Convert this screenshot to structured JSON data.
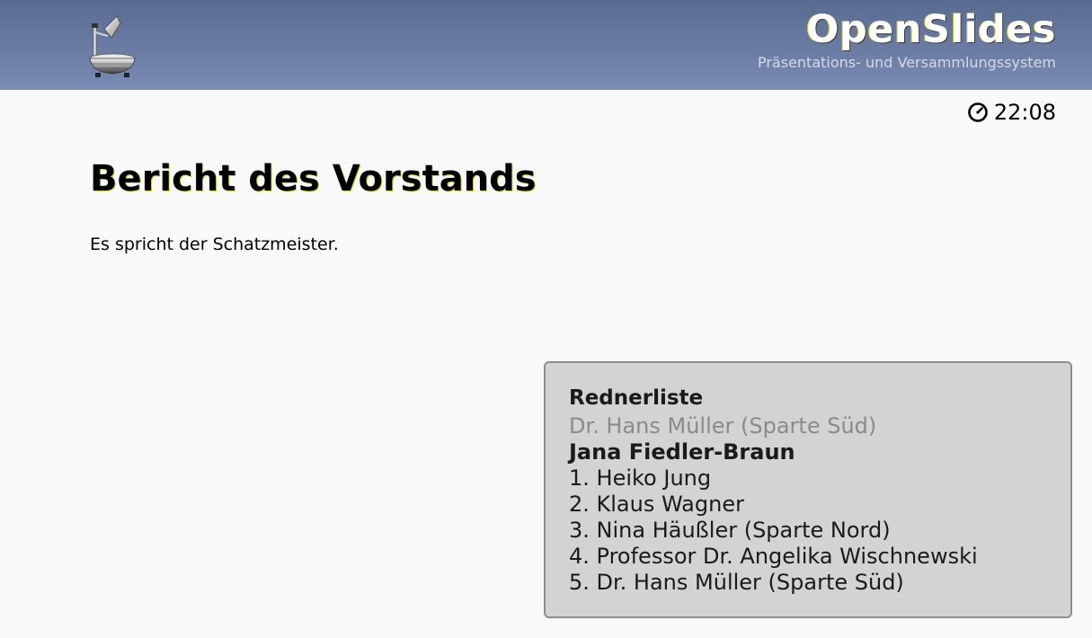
{
  "header": {
    "brand_title": "OpenSlides",
    "brand_subtitle": "Präsentations- und Versammlungssystem",
    "logo_icon": "overhead-projector-icon",
    "background_color": "#6a7ca3"
  },
  "clock": {
    "icon": "clock-icon",
    "time": "22:08"
  },
  "slide": {
    "title": "Bericht des Vorstands",
    "text": "Es spricht der Schatzmeister."
  },
  "speaker_list": {
    "title": "Rednerliste",
    "last_speaker": "Dr. Hans Müller (Sparte Süd)",
    "current_speaker": "Jana Fiedler-Braun",
    "queue": [
      "1. Heiko Jung",
      "2. Klaus Wagner",
      "3. Nina Häußler (Sparte Nord)",
      "4. Professor Dr. Angelika Wischnewski",
      "5. Dr. Hans Müller (Sparte Süd)"
    ],
    "box_color": "#d3d3d3"
  }
}
